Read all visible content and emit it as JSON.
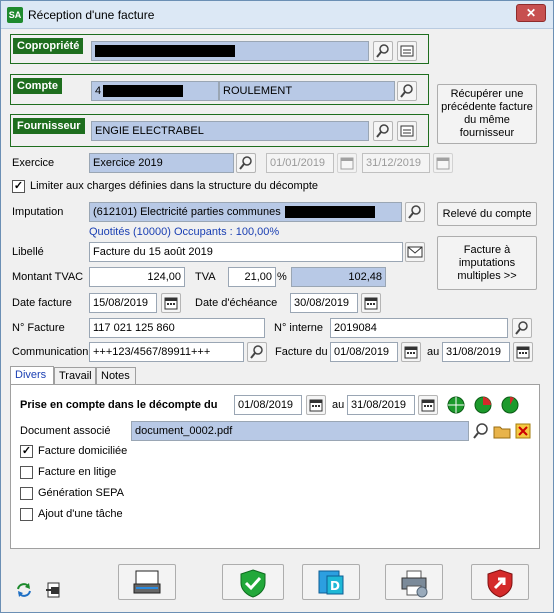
{
  "window": {
    "title": "Réception d'une facture",
    "app_icon_text": "SA",
    "close_label": "✕"
  },
  "copropriete": {
    "label": "Copropriété"
  },
  "compte": {
    "label": "Compte",
    "prefix": "4",
    "roulement": "ROULEMENT"
  },
  "fournisseur": {
    "label": "Fournisseur",
    "value": "ENGIE ELECTRABEL"
  },
  "recuperer_button": "Récupérer une précédente facture du même fournisseur",
  "exercice": {
    "label": "Exercice",
    "value": "Exercice 2019",
    "date_from": "01/01/2019",
    "date_to": "31/12/2019"
  },
  "limiter_checkbox": {
    "label": "Limiter aux charges définies dans la structure du décompte",
    "checked": true
  },
  "imputation": {
    "label": "Imputation",
    "value": "(612101) Electricité parties communes",
    "quotites": "Quotités (10000) Occupants : 100,00%"
  },
  "releve_button": "Relevé du compte",
  "libelle": {
    "label": "Libellé",
    "value": "Facture du 15 août 2019"
  },
  "facture_multiples_button": "Facture à imputations multiples >>",
  "montant": {
    "label": "Montant TVAC",
    "value": "124,00",
    "tva_label": "TVA",
    "tva_value": "21,00",
    "tva_unit": "%",
    "htva": "102,48"
  },
  "date_facture": {
    "label": "Date facture",
    "value": "15/08/2019",
    "echeance_label": "Date d'échéance",
    "echeance_value": "30/08/2019"
  },
  "numero": {
    "label": "N° Facture",
    "value": "117 021 125 860",
    "interne_label": "N° interne",
    "interne_value": "2019084"
  },
  "communication": {
    "label": "Communication",
    "value": "+++123/4567/89911+++",
    "facture_du_label": "Facture du",
    "facture_du_value": "01/08/2019",
    "au_label": "au",
    "au_value": "31/08/2019"
  },
  "tabs": [
    {
      "label": "Divers",
      "active": true
    },
    {
      "label": "Travail",
      "active": false
    },
    {
      "label": "Notes",
      "active": false
    }
  ],
  "divers": {
    "prise_label": "Prise en compte dans le décompte du",
    "prise_from": "01/08/2019",
    "prise_au_label": "au",
    "prise_to": "31/08/2019",
    "document_label": "Document associé",
    "document_value": "document_0002.pdf",
    "checkboxes": [
      {
        "label": "Facture domiciliée",
        "checked": true
      },
      {
        "label": "Facture en litige",
        "checked": false
      },
      {
        "label": "Génération SEPA",
        "checked": false
      },
      {
        "label": "Ajout d'une tâche",
        "checked": false
      }
    ]
  },
  "colors": {
    "group_green": "#1e6e1e",
    "field_blue": "#b8c9e6",
    "link_blue": "#1a3fb3"
  }
}
